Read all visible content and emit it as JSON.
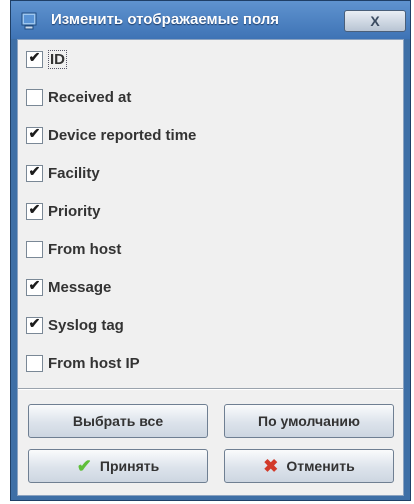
{
  "window": {
    "title": "Изменить отображаемые поля",
    "close_glyph": "X"
  },
  "fields": [
    {
      "label": "ID",
      "checked": true
    },
    {
      "label": "Received at",
      "checked": false
    },
    {
      "label": "Device reported time",
      "checked": true
    },
    {
      "label": "Facility",
      "checked": true
    },
    {
      "label": "Priority",
      "checked": true
    },
    {
      "label": "From host",
      "checked": false
    },
    {
      "label": "Message",
      "checked": true
    },
    {
      "label": "Syslog tag",
      "checked": true
    },
    {
      "label": "From host IP",
      "checked": false
    }
  ],
  "buttons": {
    "select_all": "Выбрать все",
    "default": "По умолчанию",
    "accept": "Принять",
    "cancel": "Отменить"
  },
  "icons": {
    "accept": "checkmark-icon",
    "cancel": "x-icon",
    "app": "window-app-icon"
  },
  "colors": {
    "titlebar": "#3e73b5",
    "accept_icon": "#5fbf3a",
    "cancel_icon": "#d23a2a"
  }
}
